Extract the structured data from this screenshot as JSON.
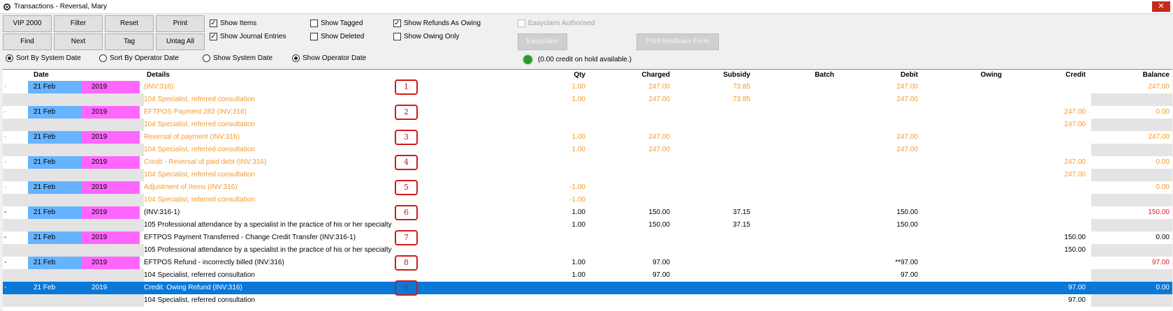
{
  "window": {
    "title": "Transactions - Reversal, Mary",
    "close_label": "✕"
  },
  "toolbar": {
    "buttons": [
      [
        "VIP 2000",
        "Filter",
        "Reset",
        "Print"
      ],
      [
        "Find",
        "Next",
        "Tag",
        "Untag All"
      ]
    ],
    "checkboxes": [
      {
        "label": "Show Items",
        "checked": true
      },
      {
        "label": "Show Journal Entries",
        "checked": true
      },
      {
        "label": "Show Tagged",
        "checked": false
      },
      {
        "label": "Show Deleted",
        "checked": false
      },
      {
        "label": "Show Refunds As Owing",
        "checked": true
      },
      {
        "label": "Show Owing Only",
        "checked": false
      },
      {
        "label": "Easyclaim Authorised",
        "checked": false,
        "disabled": true
      }
    ],
    "radios": [
      {
        "label": "Sort By System Date",
        "selected": true
      },
      {
        "label": "Sort By Operator Date",
        "selected": false
      },
      {
        "label": "Show System Date",
        "selected": false
      },
      {
        "label": "Show Operator Date",
        "selected": true
      }
    ],
    "easyclaim_label": "Easyclaim",
    "print_medicare_label": "Print Medicare Form",
    "credit_hold_text": "(0.00 credit on hold available.)"
  },
  "grid": {
    "headers": {
      "date": "Date",
      "details": "Details",
      "qty": "Qty",
      "charged": "Charged",
      "subsidy": "Subsidy",
      "batch": "Batch",
      "debit": "Debit",
      "owing": "Owing",
      "credit": "Credit",
      "balance": "Balance"
    },
    "transactions": [
      {
        "n": "1",
        "date": "21 Feb",
        "year": "2019",
        "details": "(INV:316)",
        "qty": "1.00",
        "charged": "247.00",
        "subsidy": "73.85",
        "debit": "247.00",
        "credit": "",
        "balance": "247.00",
        "sub_details": "104 Specialist, referred consultation",
        "sub_qty": "1.00",
        "sub_charged": "247.00",
        "sub_subsidy": "73.85",
        "sub_debit": "247.00",
        "sub_credit": "",
        "color": "#f39a2e",
        "balance_color": "#f39a2e"
      },
      {
        "n": "2",
        "date": "21 Feb",
        "year": "2019",
        "details": "EFTPOS Payment  283  (INV:316)",
        "qty": "",
        "charged": "",
        "subsidy": "",
        "debit": "",
        "credit": "247.00",
        "balance": "0.00",
        "sub_details": "104 Specialist, referred consultation",
        "sub_qty": "",
        "sub_charged": "",
        "sub_subsidy": "",
        "sub_debit": "",
        "sub_credit": "247.00",
        "color": "#f39a2e",
        "balance_color": "#f39a2e"
      },
      {
        "n": "3",
        "date": "21 Feb",
        "year": "2019",
        "details": "Reversal of payment (INV:316)",
        "qty": "1.00",
        "charged": "247.00",
        "subsidy": "",
        "debit": "247.00",
        "credit": "",
        "balance": "247.00",
        "sub_details": "104 Specialist, referred consultation",
        "sub_qty": "1.00",
        "sub_charged": "247.00",
        "sub_subsidy": "",
        "sub_debit": "247.00",
        "sub_credit": "",
        "color": "#f39a2e",
        "balance_color": "#f39a2e"
      },
      {
        "n": "4",
        "date": "21 Feb",
        "year": "2019",
        "details": "Credit - Reversal of paid debt (INV:316)",
        "qty": "",
        "charged": "",
        "subsidy": "",
        "debit": "",
        "credit": "247.00",
        "balance": "0.00",
        "sub_details": "104 Specialist, referred consultation",
        "sub_qty": "",
        "sub_charged": "",
        "sub_subsidy": "",
        "sub_debit": "",
        "sub_credit": "247.00",
        "color": "#f39a2e",
        "balance_color": "#f39a2e"
      },
      {
        "n": "5",
        "date": "21 Feb",
        "year": "2019",
        "details": "Adjustment of Items (INV:316)",
        "qty": "-1.00",
        "charged": "",
        "subsidy": "",
        "debit": "",
        "credit": "",
        "balance": "0.00",
        "sub_details": "104 Specialist, referred consultation",
        "sub_qty": "-1.00",
        "sub_charged": "",
        "sub_subsidy": "",
        "sub_debit": "",
        "sub_credit": "",
        "color": "#f39a2e",
        "balance_color": "#f39a2e"
      },
      {
        "n": "6",
        "date": "21 Feb",
        "year": "2019",
        "details": "(INV:316-1)",
        "qty": "1.00",
        "charged": "150.00",
        "subsidy": "37.15",
        "debit": "150.00",
        "credit": "",
        "balance": "150.00",
        "sub_details": "105 Professional attendance by a specialist in the practice of his or her specialty",
        "sub_qty": "1.00",
        "sub_charged": "150.00",
        "sub_subsidy": "37.15",
        "sub_debit": "150.00",
        "sub_credit": "",
        "color": "#000000",
        "balance_color": "#d81e1e"
      },
      {
        "n": "7",
        "date": "21 Feb",
        "year": "2019",
        "details": "EFTPOS Payment Transferred - Change Credit Transfer (INV:316-1)",
        "qty": "",
        "charged": "",
        "subsidy": "",
        "debit": "",
        "credit": "150.00",
        "balance": "0.00",
        "sub_details": "105 Professional attendance by a specialist in the practice of his or her specialty",
        "sub_qty": "",
        "sub_charged": "",
        "sub_subsidy": "",
        "sub_debit": "",
        "sub_credit": "150.00",
        "color": "#000000",
        "balance_color": "#000000"
      },
      {
        "n": "8",
        "date": "21 Feb",
        "year": "2019",
        "details": "EFTPOS Refund - incorrectly billed (INV:316)",
        "qty": "1.00",
        "charged": "97.00",
        "subsidy": "",
        "debit": "**97.00",
        "credit": "",
        "balance": "97.00",
        "sub_details": "104 Specialist, referred consultation",
        "sub_qty": "1.00",
        "sub_charged": "97.00",
        "sub_subsidy": "",
        "sub_debit": "97.00",
        "sub_credit": "",
        "color": "#000000",
        "balance_color": "#d81e1e"
      },
      {
        "n": "9",
        "date": "21 Feb",
        "year": "2019",
        "details": "Credit: Owing Refund (INV:316)",
        "qty": "",
        "charged": "",
        "subsidy": "",
        "debit": "",
        "credit": "97.00",
        "balance": "0.00",
        "sub_details": "104 Specialist, referred consultation",
        "sub_qty": "",
        "sub_charged": "",
        "sub_subsidy": "",
        "sub_debit": "",
        "sub_credit": "97.00",
        "color": "#000000",
        "balance_color": "#000000",
        "selected": true
      }
    ]
  },
  "colors": {
    "date_cell": "#66b3ff",
    "year_cell": "#ff66ff",
    "selected_row": "#0a78d7",
    "sub_row": "#e4e4e4",
    "annotation": "#d21919"
  }
}
